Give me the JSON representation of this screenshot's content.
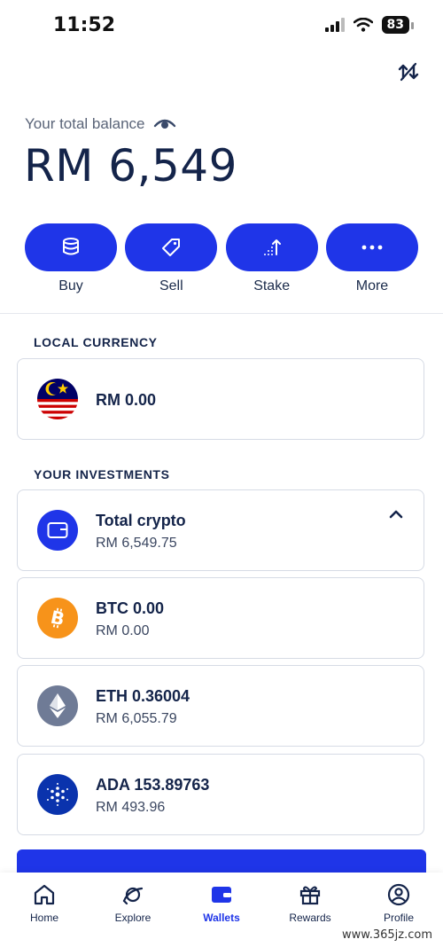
{
  "status_bar": {
    "time": "11:52",
    "battery": "83"
  },
  "balance": {
    "label": "Your total balance",
    "value": "RM 6,549"
  },
  "actions": [
    {
      "label": "Buy",
      "icon": "coins-stack-icon"
    },
    {
      "label": "Sell",
      "icon": "tag-icon"
    },
    {
      "label": "Stake",
      "icon": "stake-arrow-icon"
    },
    {
      "label": "More",
      "icon": "more-dots-icon"
    }
  ],
  "local_currency": {
    "title": "LOCAL CURRENCY",
    "amount": "RM 0.00",
    "icon": "malaysia-flag-icon"
  },
  "investments": {
    "title": "YOUR INVESTMENTS",
    "total": {
      "name": "Total crypto",
      "value": "RM 6,549.75",
      "icon": "wallet-icon"
    },
    "assets": [
      {
        "name": "BTC 0.00",
        "value": "RM 0.00",
        "icon": "bitcoin-icon",
        "color": "#f7931a"
      },
      {
        "name": "ETH 0.36004",
        "value": "RM 6,055.79",
        "icon": "ethereum-icon",
        "color": "#6f7b96"
      },
      {
        "name": "ADA 153.89763",
        "value": "RM 493.96",
        "icon": "cardano-icon",
        "color": "#0a33ad"
      }
    ]
  },
  "nav": [
    {
      "label": "Home",
      "icon": "home-icon",
      "active": false
    },
    {
      "label": "Explore",
      "icon": "explore-icon",
      "active": false
    },
    {
      "label": "Wallets",
      "icon": "wallet-icon",
      "active": true
    },
    {
      "label": "Rewards",
      "icon": "gift-icon",
      "active": false
    },
    {
      "label": "Profile",
      "icon": "profile-icon",
      "active": false
    }
  ],
  "watermark": "www.365jz.com",
  "colors": {
    "accent": "#1f35e8",
    "text_dark": "#14244a",
    "card_border": "#d6dbe5"
  }
}
